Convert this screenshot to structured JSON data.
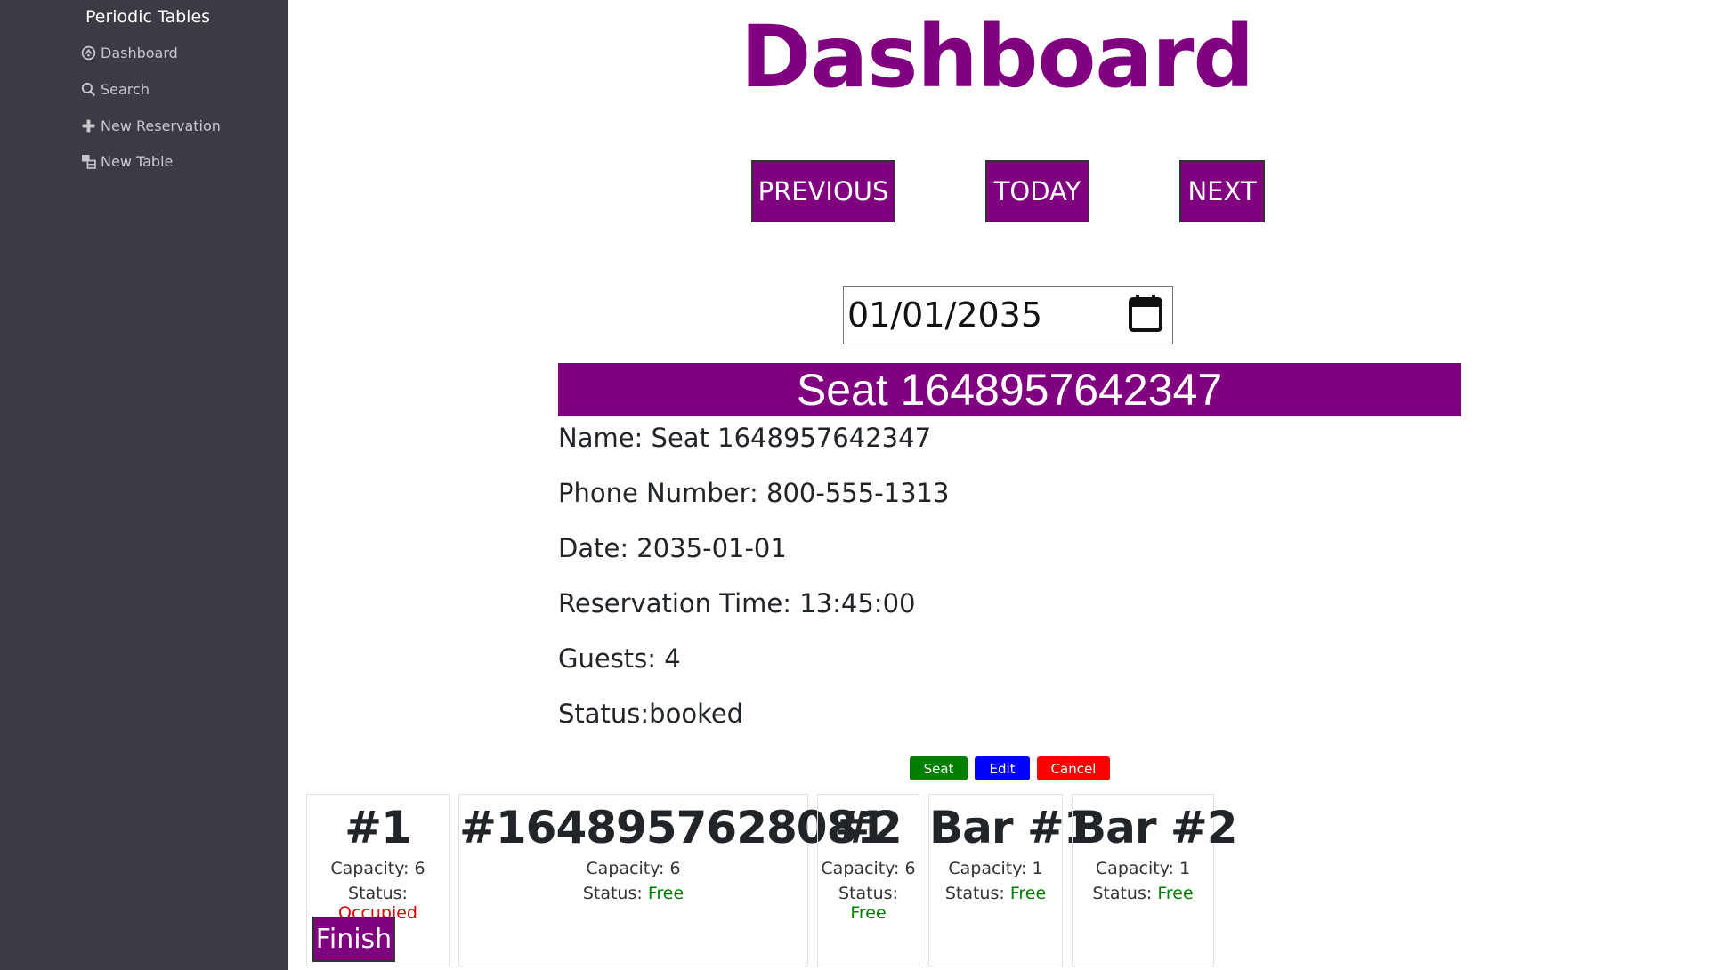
{
  "sidebar": {
    "brand": "Periodic Tables",
    "items": [
      {
        "label": "Dashboard",
        "icon": "dashboard-icon"
      },
      {
        "label": "Search",
        "icon": "search-icon"
      },
      {
        "label": "New Reservation",
        "icon": "plus-icon"
      },
      {
        "label": "New Table",
        "icon": "table-icon"
      }
    ]
  },
  "header": {
    "title": "Dashboard",
    "previous_label": "PREVIOUS",
    "today_label": "TODAY",
    "next_label": "NEXT"
  },
  "date_picker": {
    "value": "01/01/2035",
    "icon": "calendar-icon"
  },
  "reservation": {
    "title": "Seat 1648957642347",
    "name": "Name: Seat 1648957642347",
    "phone": "Phone Number: 800-555-1313",
    "date": "Date: 2035-01-01",
    "time": "Reservation Time: 13:45:00",
    "guests": "Guests: 4",
    "status": "Status:booked",
    "actions": {
      "seat": "Seat",
      "edit": "Edit",
      "cancel": "Cancel"
    }
  },
  "tables": [
    {
      "name": "#1",
      "capacity_label": "Capacity: 6",
      "status_prefix": "Status: ",
      "status": "Occupied",
      "finish_label": "Finish"
    },
    {
      "name": "#1648957628081",
      "capacity_label": "Capacity: 6",
      "status_prefix": "Status: ",
      "status": "Free"
    },
    {
      "name": "#2",
      "capacity_label": "Capacity: 6",
      "status_prefix": "Status: ",
      "status": "Free"
    },
    {
      "name": "Bar #1",
      "capacity_label": "Capacity: 1",
      "status_prefix": "Status: ",
      "status": "Free"
    },
    {
      "name": "Bar #2",
      "capacity_label": "Capacity: 1",
      "status_prefix": "Status: ",
      "status": "Free"
    }
  ],
  "colors": {
    "sidebar_bg": "#3a3b44",
    "accent": "#800080",
    "seat": "#008000",
    "edit": "#0000ff",
    "cancel": "#ff0000",
    "occupied": "#e00000",
    "free": "#008000"
  }
}
